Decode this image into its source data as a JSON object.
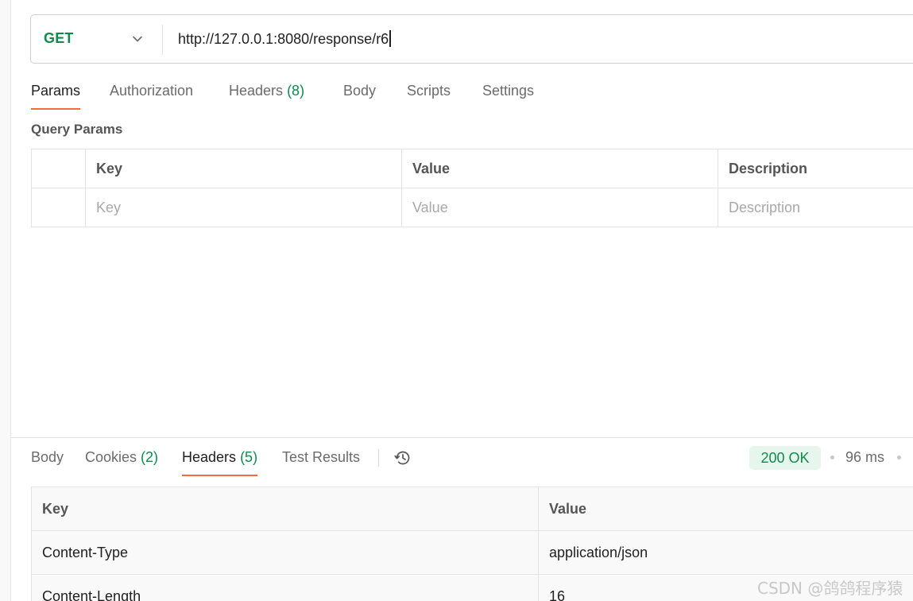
{
  "request": {
    "method": "GET",
    "url": "http://127.0.0.1:8080/response/r6"
  },
  "request_tabs": [
    {
      "label": "Params",
      "count": ""
    },
    {
      "label": "Authorization",
      "count": ""
    },
    {
      "label": "Headers",
      "count": "(8)"
    },
    {
      "label": "Body",
      "count": ""
    },
    {
      "label": "Scripts",
      "count": ""
    },
    {
      "label": "Settings",
      "count": ""
    }
  ],
  "query_params": {
    "title": "Query Params",
    "columns": [
      "Key",
      "Value",
      "Description"
    ],
    "placeholders": [
      "Key",
      "Value",
      "Description"
    ]
  },
  "response_tabs": [
    {
      "label": "Body",
      "count": ""
    },
    {
      "label": "Cookies",
      "count": "(2)"
    },
    {
      "label": "Headers",
      "count": "(5)"
    },
    {
      "label": "Test Results",
      "count": ""
    }
  ],
  "response_status": {
    "status": "200 OK",
    "time": "96 ms"
  },
  "response_headers": {
    "columns": [
      "Key",
      "Value"
    ],
    "rows": [
      {
        "key": "Content-Type",
        "value": "application/json"
      },
      {
        "key": "Content-Length",
        "value": "16"
      }
    ]
  },
  "watermark": "CSDN @鸽鸽程序猿",
  "colors": {
    "accent": "#f26b3a",
    "method_green": "#0f8a4d",
    "status_bg": "#e6f6ec"
  }
}
